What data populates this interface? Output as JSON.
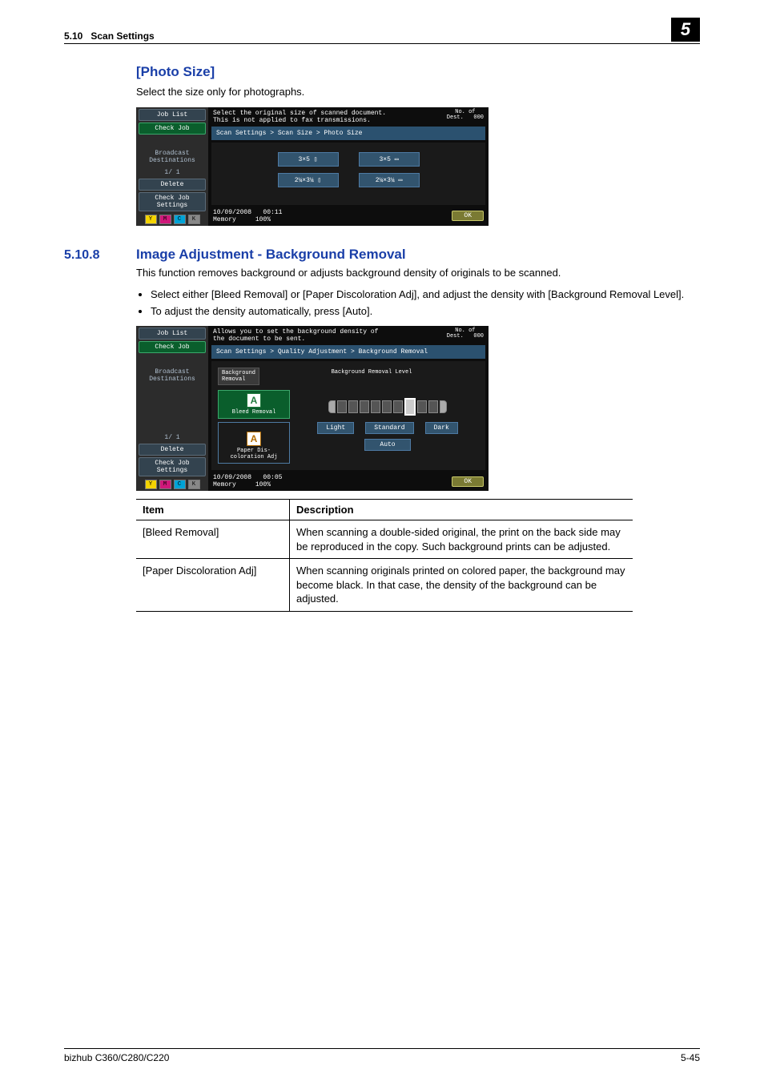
{
  "header": {
    "section_num": "5.10",
    "section_title": "Scan Settings",
    "chapter": "5"
  },
  "photo": {
    "heading": "[Photo Size]",
    "intro": "Select the size only for photographs."
  },
  "panel1": {
    "joblist": "Job List",
    "checkjob": "Check Job",
    "broadcast": "Broadcast\nDestinations",
    "page": "1/  1",
    "delete": "Delete",
    "cjs": "Check Job\nSettings",
    "msg": "Select the original size of scanned document.\nThis is not applied to fax transmissions.",
    "dest_lbl": "No. of\nDest.",
    "dest_val": "000",
    "breadcrumb": "Scan Settings > Scan Size > Photo Size",
    "sizes": {
      "a": "3×5 ▯",
      "b": "3×5 ▭",
      "c": "2¼×3¼ ▯",
      "d": "2¼×3¼ ▭"
    },
    "date": "10/09/2008",
    "time": "00:11",
    "mem": "Memory",
    "mem_v": "100%",
    "ok": "OK",
    "toner": {
      "y": "Y",
      "m": "M",
      "c": "C",
      "k": "K"
    }
  },
  "bgremoval": {
    "num": "5.10.8",
    "title": "Image Adjustment - Background Removal",
    "intro": "This function removes background or adjusts background density of originals to be scanned.",
    "b1": "Select either [Bleed Removal] or [Paper Discoloration Adj], and adjust the density with [Background Removal Level].",
    "b2": "To adjust the density automatically, press [Auto]."
  },
  "panel2": {
    "msg": "Allows you to set the background density of\nthe document to be sent.",
    "breadcrumb": "Scan Settings > Quality Adjustment > Background Removal",
    "bg_tab": "Background\nRemoval",
    "level_title": "Background Removal Level",
    "bleed": "Bleed Removal",
    "paper": "Paper Dis-\ncoloration Adj",
    "light": "Light",
    "standard": "Standard",
    "dark": "Dark",
    "auto": "Auto",
    "time": "00:05",
    "ok": "OK"
  },
  "table": {
    "h1": "Item",
    "h2": "Description",
    "r1a": "[Bleed Removal]",
    "r1b": "When scanning a double-sided original, the print on the back side may be reproduced in the copy. Such background prints can be adjusted.",
    "r2a": "[Paper Discoloration Adj]",
    "r2b": "When scanning originals printed on colored paper, the background may become black. In that case, the density of the background can be adjusted."
  },
  "footer": {
    "model": "bizhub C360/C280/C220",
    "page": "5-45"
  }
}
